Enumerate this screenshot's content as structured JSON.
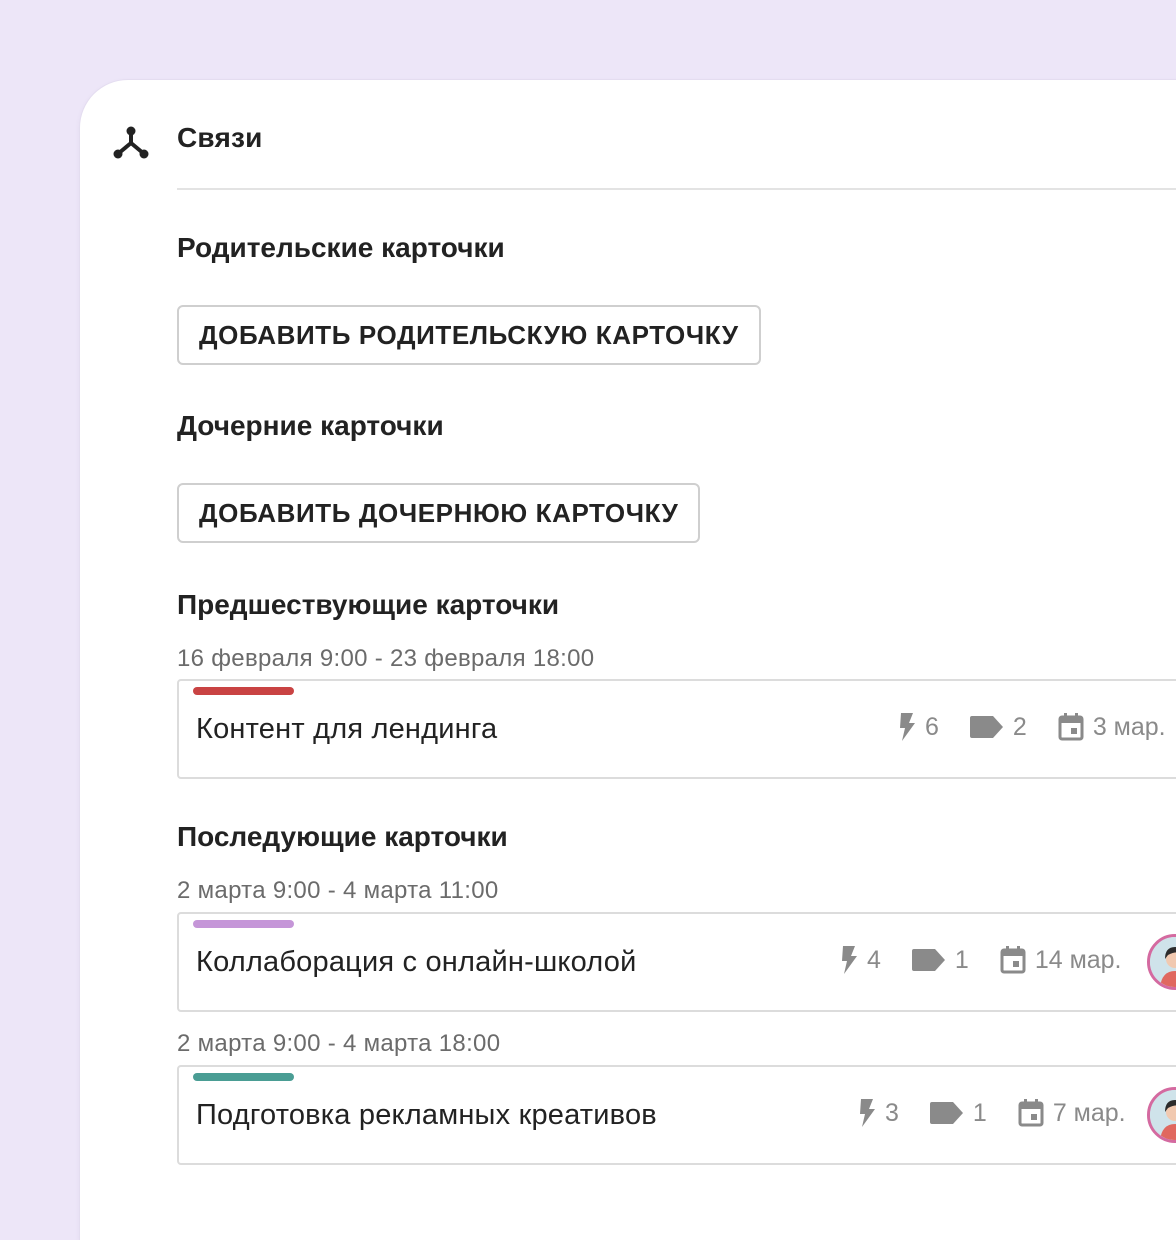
{
  "header": {
    "title": "Связи",
    "icon": "links-icon"
  },
  "parents": {
    "title": "Родительские карточки",
    "add_button": "ДОБАВИТЬ РОДИТЕЛЬСКУЮ КАРТОЧКУ"
  },
  "children": {
    "title": "Дочерние карточки",
    "add_button": "ДОБАВИТЬ ДОЧЕРНЮЮ КАРТОЧКУ"
  },
  "predecessors": {
    "title": "Предшествующие карточки",
    "cards": [
      {
        "dates": "16 февраля 9:00 - 23 февраля 18:00",
        "title": "Контент для лендинга",
        "color": "#c94343",
        "bolts": "6",
        "tags": "2",
        "due": "3 мар."
      }
    ]
  },
  "successors": {
    "title": "Последующие карточки",
    "cards": [
      {
        "dates": "2 марта 9:00 - 4 марта 11:00",
        "title": "Коллаборация с онлайн-школой",
        "color": "#c596d8",
        "bolts": "4",
        "tags": "1",
        "due": "14 мар."
      },
      {
        "dates": "2 марта 9:00 - 4 марта 18:00",
        "title": "Подготовка рекламных креативов",
        "color": "#4a9d94",
        "bolts": "3",
        "tags": "1",
        "due": "7 мар."
      }
    ]
  }
}
